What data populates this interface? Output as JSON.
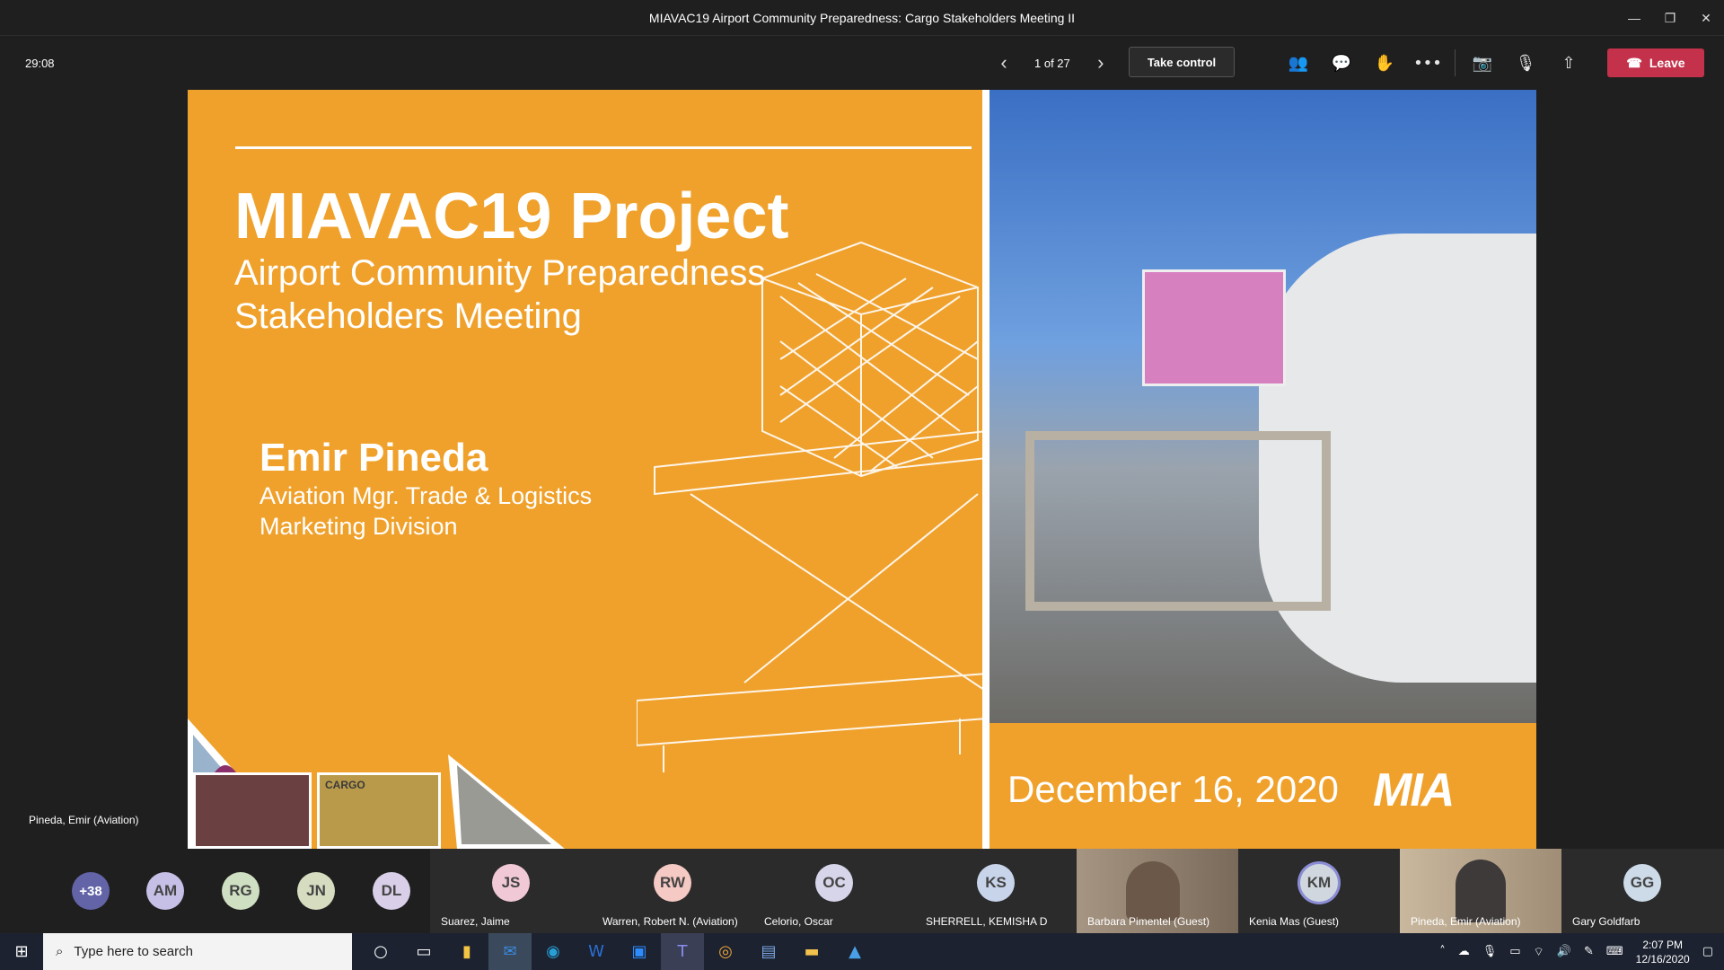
{
  "window": {
    "title": "MIAVAC19 Airport Community Preparedness: Cargo Stakeholders Meeting II",
    "controls": [
      "—",
      "❐",
      "✕"
    ]
  },
  "toolbar": {
    "timer": "29:08",
    "page_indicator": "1 of 27",
    "prev_icon": "‹",
    "next_icon": "›",
    "take_control_label": "Take control",
    "icons": [
      "people-icon",
      "chat-icon",
      "raise-hand-icon",
      "more-icon",
      "camera-off-icon",
      "mic-off-icon",
      "share-icon"
    ],
    "icon_glyphs": [
      "👥",
      "💬",
      "✋",
      "•••",
      "📷",
      "🎙",
      "⇧"
    ],
    "leave_label": "Leave",
    "leave_color": "#c4314b"
  },
  "slide": {
    "title": "MIAVAC19 Project",
    "subtitle_line1": "Airport Community Preparedness",
    "subtitle_line2": "Stakeholders Meeting",
    "presenter": "Emir Pineda",
    "role_line1": "Aviation Mgr. Trade & Logistics",
    "role_line2": "Marketing Division",
    "date": "December 16, 2020",
    "logo": "MIA",
    "thumb_label": "CARGO",
    "background_color": "#f0a12b"
  },
  "video_caption": "Pineda, Emir (Aviation)",
  "gallery": {
    "overflow_count": "+38",
    "avatars": [
      {
        "initials": "AM",
        "color": "#c6c0e6"
      },
      {
        "initials": "RG",
        "color": "#cfe0c2"
      },
      {
        "initials": "JN",
        "color": "#d6dcc0"
      },
      {
        "initials": "DL",
        "color": "#d9cfe8"
      }
    ],
    "tiles": [
      {
        "initials": "JS",
        "name": "Suarez, Jaime",
        "color": "#f0c8d6"
      },
      {
        "initials": "RW",
        "name": "Warren, Robert N. (Aviation)",
        "color": "#f5c9c4"
      },
      {
        "initials": "OC",
        "name": "Celorio, Oscar",
        "color": "#d7d5e9"
      },
      {
        "initials": "KS",
        "name": "SHERRELL, KEMISHA D",
        "color": "#c8d4ea"
      },
      {
        "initials": "",
        "name": "Barbara Pimentel (Guest)",
        "color": "#8b7b6a"
      },
      {
        "initials": "KM",
        "name": "Kenia Mas (Guest)",
        "color": "#d0d7de"
      },
      {
        "initials": "",
        "name": "Pineda, Emir (Aviation)",
        "color": "#b9a68f"
      },
      {
        "initials": "GG",
        "name": "Gary Goldfarb",
        "color": "#cddbe8"
      }
    ]
  },
  "taskbar": {
    "search_placeholder": "Type here to search",
    "time": "2:07 PM",
    "date": "12/16/2020"
  }
}
